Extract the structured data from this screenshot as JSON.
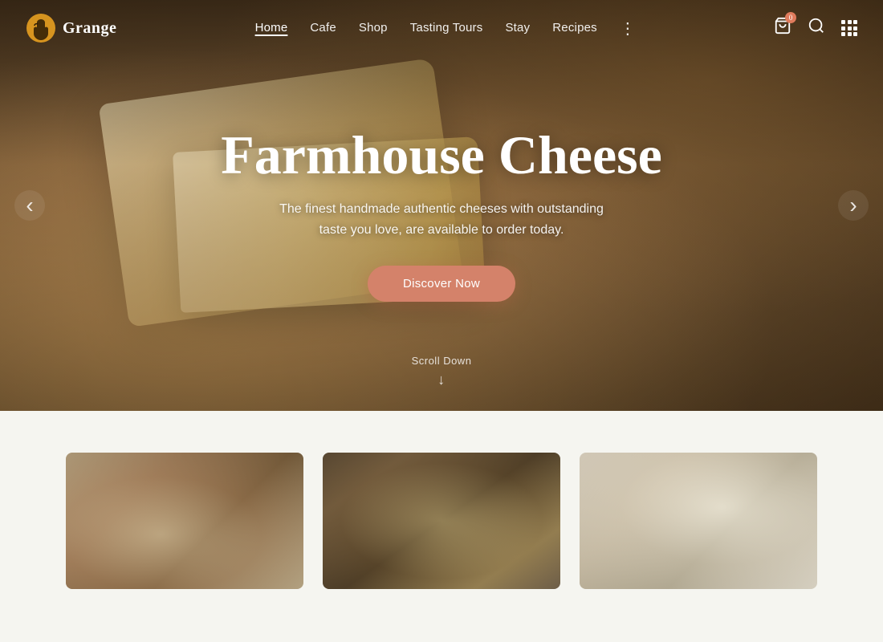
{
  "logo": {
    "name": "Grange",
    "icon": "hand-icon"
  },
  "nav": {
    "links": [
      {
        "label": "Home",
        "active": true
      },
      {
        "label": "Cafe",
        "active": false
      },
      {
        "label": "Shop",
        "active": false
      },
      {
        "label": "Tasting Tours",
        "active": false
      },
      {
        "label": "Stay",
        "active": false
      },
      {
        "label": "Recipes",
        "active": false
      }
    ],
    "more_icon": "⋮"
  },
  "hero": {
    "title": "Farmhouse Cheese",
    "subtitle": "The finest handmade authentic cheeses with outstanding taste you love, are available to order today.",
    "cta_label": "Discover Now",
    "scroll_label": "Scroll Down",
    "prev_label": "‹",
    "next_label": "›"
  },
  "cards": [
    {
      "id": 1,
      "alt": "Soft round cheese"
    },
    {
      "id": 2,
      "alt": "Blue cheese with herbs"
    },
    {
      "id": 3,
      "alt": "White block cheese"
    }
  ],
  "icons": {
    "cart": "🛒",
    "search": "🔍",
    "grid": "grid"
  }
}
